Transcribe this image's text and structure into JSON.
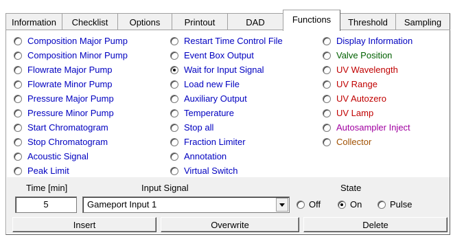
{
  "tabs": [
    {
      "label": "Information"
    },
    {
      "label": "Checklist"
    },
    {
      "label": "Options"
    },
    {
      "label": "Printout"
    },
    {
      "label": "DAD"
    },
    {
      "label": "Functions"
    },
    {
      "label": "Threshold"
    },
    {
      "label": "Sampling"
    }
  ],
  "active_tab": "Functions",
  "colors": {
    "blue": "#0000c0",
    "green": "#006000",
    "red": "#c00000",
    "purple": "#a000a0",
    "brown": "#a05000"
  },
  "functions": {
    "col1": [
      {
        "label": "Composition Major Pump",
        "checked": false
      },
      {
        "label": "Composition Minor Pump",
        "checked": false
      },
      {
        "label": "Flowrate Major Pump",
        "checked": false
      },
      {
        "label": "Flowrate Minor Pump",
        "checked": false
      },
      {
        "label": "Pressure Major Pump",
        "checked": false
      },
      {
        "label": "Pressure Minor Pump",
        "checked": false
      },
      {
        "label": "Start Chromatogram",
        "checked": false
      },
      {
        "label": "Stop Chromatogram",
        "checked": false
      },
      {
        "label": "Acoustic Signal",
        "checked": false
      },
      {
        "label": "Peak Limit",
        "checked": false
      }
    ],
    "col2": [
      {
        "label": "Restart Time Control File",
        "checked": false
      },
      {
        "label": "Event Box Output",
        "checked": false
      },
      {
        "label": "Wait for Input Signal",
        "checked": true
      },
      {
        "label": "Load new File",
        "checked": false
      },
      {
        "label": "Auxiliary Output",
        "checked": false
      },
      {
        "label": "Temperature",
        "checked": false
      },
      {
        "label": "Stop all",
        "checked": false
      },
      {
        "label": "Fraction Limiter",
        "checked": false
      },
      {
        "label": "Annotation",
        "checked": false
      },
      {
        "label": "Virtual Switch",
        "checked": false
      }
    ],
    "col3": [
      {
        "label": "Display Information",
        "color": "blue",
        "checked": false
      },
      {
        "label": "Valve Position",
        "color": "green",
        "checked": false
      },
      {
        "label": "UV Wavelength",
        "color": "red",
        "checked": false
      },
      {
        "label": "UV Range",
        "color": "red",
        "checked": false
      },
      {
        "label": "UV Autozero",
        "color": "red",
        "checked": false
      },
      {
        "label": "UV Lamp",
        "color": "red",
        "checked": false
      },
      {
        "label": "Autosampler Inject",
        "color": "purple",
        "checked": false
      },
      {
        "label": "Collector",
        "color": "brown",
        "checked": false
      }
    ]
  },
  "params": {
    "time_label": "Time [min]",
    "time_value": "5",
    "input_signal_label": "Input Signal",
    "input_signal_value": "Gameport Input 1",
    "state_label": "State",
    "state_options": [
      {
        "label": "Off",
        "checked": false
      },
      {
        "label": "On",
        "checked": true
      },
      {
        "label": "Pulse",
        "checked": false
      }
    ]
  },
  "buttons": {
    "insert": "Insert",
    "overwrite": "Overwrite",
    "delete": "Delete"
  }
}
